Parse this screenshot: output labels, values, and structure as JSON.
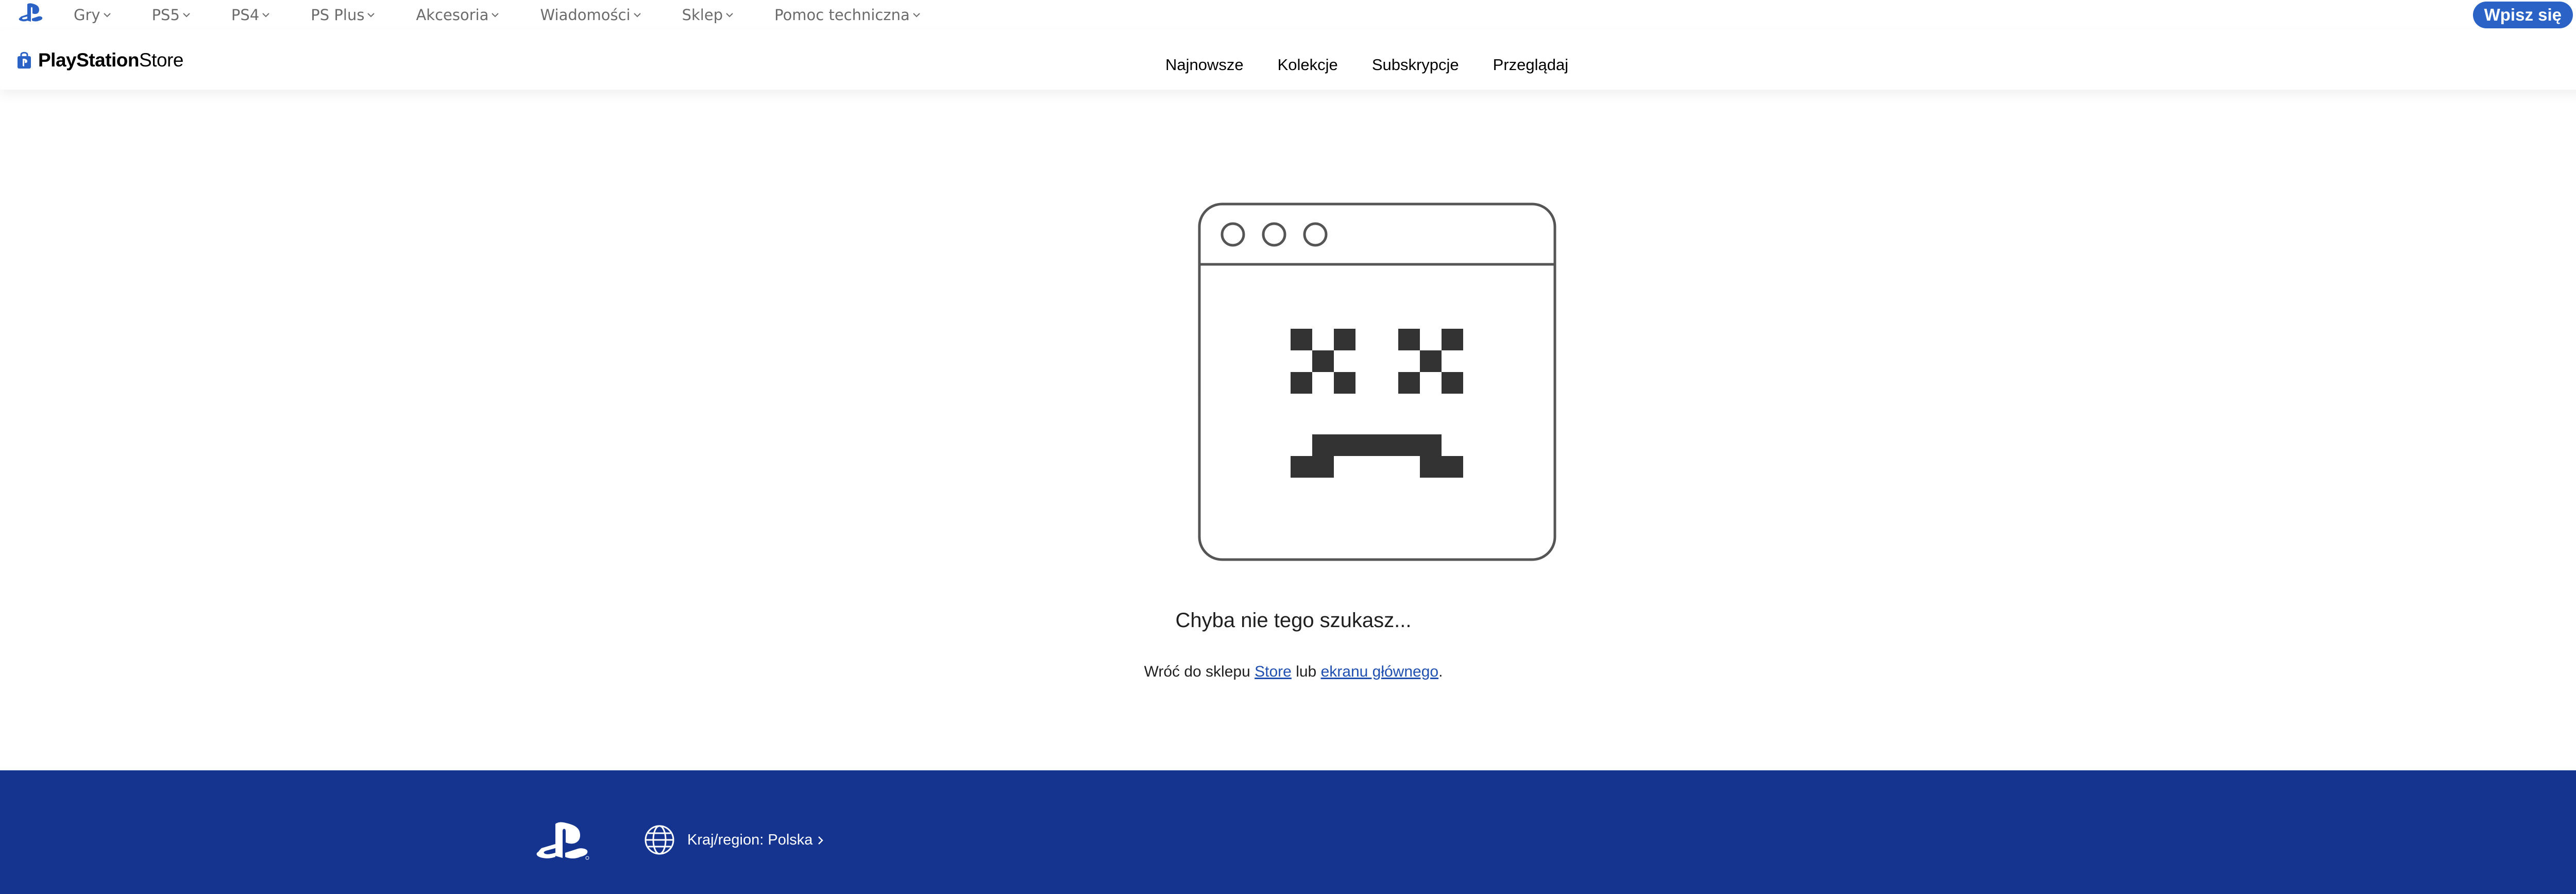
{
  "global_nav": {
    "items": [
      {
        "label": "Gry"
      },
      {
        "label": "PS5"
      },
      {
        "label": "PS4"
      },
      {
        "label": "PS Plus"
      },
      {
        "label": "Akcesoria"
      },
      {
        "label": "Wiadomości"
      },
      {
        "label": "Sklep"
      },
      {
        "label": "Pomoc techniczna"
      }
    ],
    "signin_label": "Wpisz się"
  },
  "store_header": {
    "brand_bold": "PlayStation",
    "brand_light": "Store",
    "links": [
      {
        "label": "Najnowsze"
      },
      {
        "label": "Kolekcje"
      },
      {
        "label": "Subskrypcje"
      },
      {
        "label": "Przeglądaj"
      }
    ]
  },
  "error": {
    "title": "Chyba nie tego szukasz...",
    "sub_prefix": "Wróć do sklepu",
    "store_link": "Store",
    "sub_middle": "lub",
    "home_link": "ekranu głównego",
    "sub_suffix": "."
  },
  "footer": {
    "region_label": "Kraj/region: Polska"
  },
  "colors": {
    "accent": "#2a63c5",
    "footer_bg": "#14348f",
    "link": "#1f4fb0",
    "illustration_stroke": "#555555",
    "illustration_fill": "#333333"
  },
  "icons": {
    "nav_logo": "playstation-logo-icon",
    "store_bag": "store-bag-icon",
    "nav_chevron": "chevron-down-icon",
    "error_art": "broken-browser-window-icon",
    "footer_logo": "playstation-logo-icon",
    "globe": "globe-icon",
    "region_chevron": "chevron-right-icon"
  }
}
